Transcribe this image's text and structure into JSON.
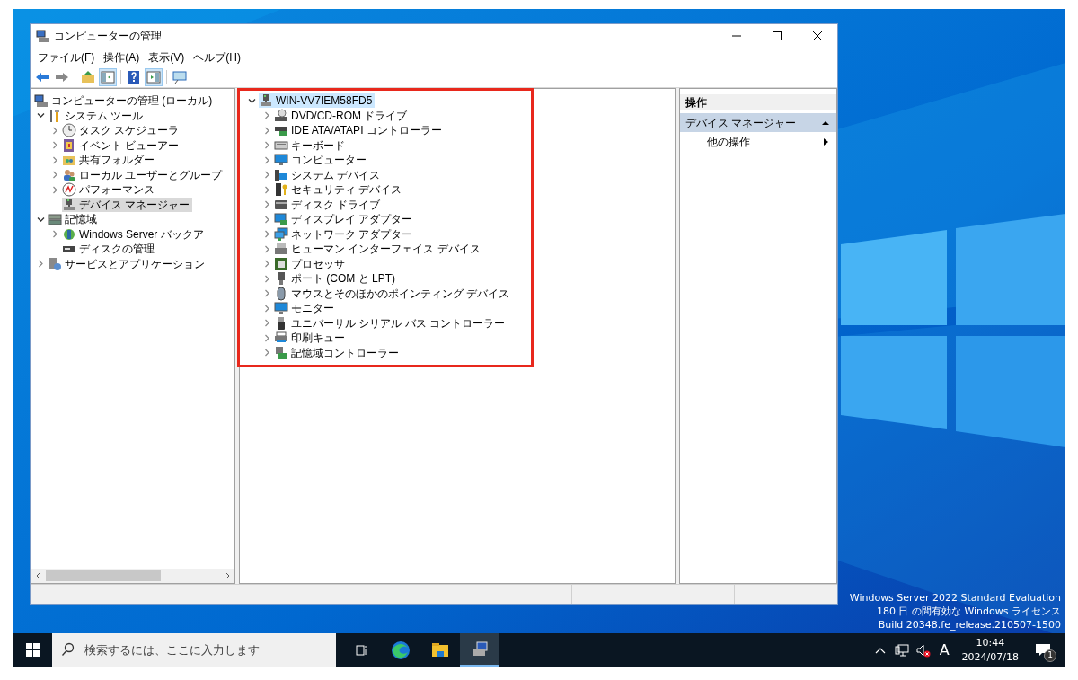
{
  "window": {
    "title": "コンピューターの管理",
    "menu": [
      "ファイル(F)",
      "操作(A)",
      "表示(V)",
      "ヘルプ(H)"
    ]
  },
  "toolbar": [
    {
      "pressed": false
    },
    {
      "pressed": false
    },
    {
      "pressed": false
    },
    {
      "pressed": true
    },
    {
      "pressed": false
    },
    {
      "pressed": true
    },
    {
      "pressed": false
    }
  ],
  "console_tree": {
    "label": "コンピューターの管理 (ローカル)",
    "selected": false,
    "children": [
      {
        "label": "システム ツール",
        "selected": false,
        "expanded": true,
        "children": [
          {
            "label": "タスク スケジューラ",
            "selected": false,
            "expanded": false
          },
          {
            "label": "イベント ビューアー",
            "selected": false,
            "expanded": false
          },
          {
            "label": "共有フォルダー",
            "selected": false,
            "expanded": false
          },
          {
            "label": "ローカル ユーザーとグループ",
            "selected": false,
            "expanded": false
          },
          {
            "label": "パフォーマンス",
            "selected": false,
            "expanded": false
          },
          {
            "label": "デバイス マネージャー",
            "selected": true
          }
        ]
      },
      {
        "label": "記憶域",
        "selected": false,
        "expanded": true,
        "children": [
          {
            "label": "Windows Server バックア",
            "selected": false,
            "expanded": false
          },
          {
            "label": "ディスクの管理",
            "selected": false
          }
        ]
      },
      {
        "label": "サービスとアプリケーション",
        "selected": false,
        "expanded": false
      }
    ]
  },
  "device_tree": {
    "label": "WIN-VV7IEM58FD5",
    "selected": true,
    "expanded": true,
    "children": [
      {
        "label": "DVD/CD-ROM ドライブ",
        "expanded": false
      },
      {
        "label": "IDE ATA/ATAPI コントローラー",
        "expanded": false
      },
      {
        "label": "キーボード",
        "expanded": false
      },
      {
        "label": "コンピューター",
        "expanded": false
      },
      {
        "label": "システム デバイス",
        "expanded": false
      },
      {
        "label": "セキュリティ デバイス",
        "expanded": false
      },
      {
        "label": "ディスク ドライブ",
        "expanded": false
      },
      {
        "label": "ディスプレイ アダプター",
        "expanded": false
      },
      {
        "label": "ネットワーク アダプター",
        "expanded": false
      },
      {
        "label": "ヒューマン インターフェイス デバイス",
        "expanded": false
      },
      {
        "label": "プロセッサ",
        "expanded": false
      },
      {
        "label": "ポート (COM と LPT)",
        "expanded": false
      },
      {
        "label": "マウスとそのほかのポインティング デバイス",
        "expanded": false
      },
      {
        "label": "モニター",
        "expanded": false
      },
      {
        "label": "ユニバーサル シリアル バス コントローラー",
        "expanded": false
      },
      {
        "label": "印刷キュー",
        "expanded": false
      },
      {
        "label": "記憶域コントローラー",
        "expanded": false
      }
    ]
  },
  "actions": {
    "title": "操作",
    "section": {
      "label": "デバイス マネージャー",
      "expanded": true
    },
    "items": [
      "他の操作"
    ]
  },
  "edition_notice": [
    "Windows Server 2022 Standard Evaluation",
    "180 日 の間有効な Windows ライセンス",
    "Build 20348.fe_release.210507-1500"
  ],
  "taskbar": {
    "search_placeholder": "検索するには、ここに入力します",
    "apps": [
      {
        "selected": false
      },
      {
        "selected": false
      },
      {
        "selected": false
      },
      {
        "selected": true
      }
    ],
    "tray": {
      "ime": "A",
      "time": "10:44",
      "date": "2024/07/18",
      "notifications": "1"
    }
  }
}
